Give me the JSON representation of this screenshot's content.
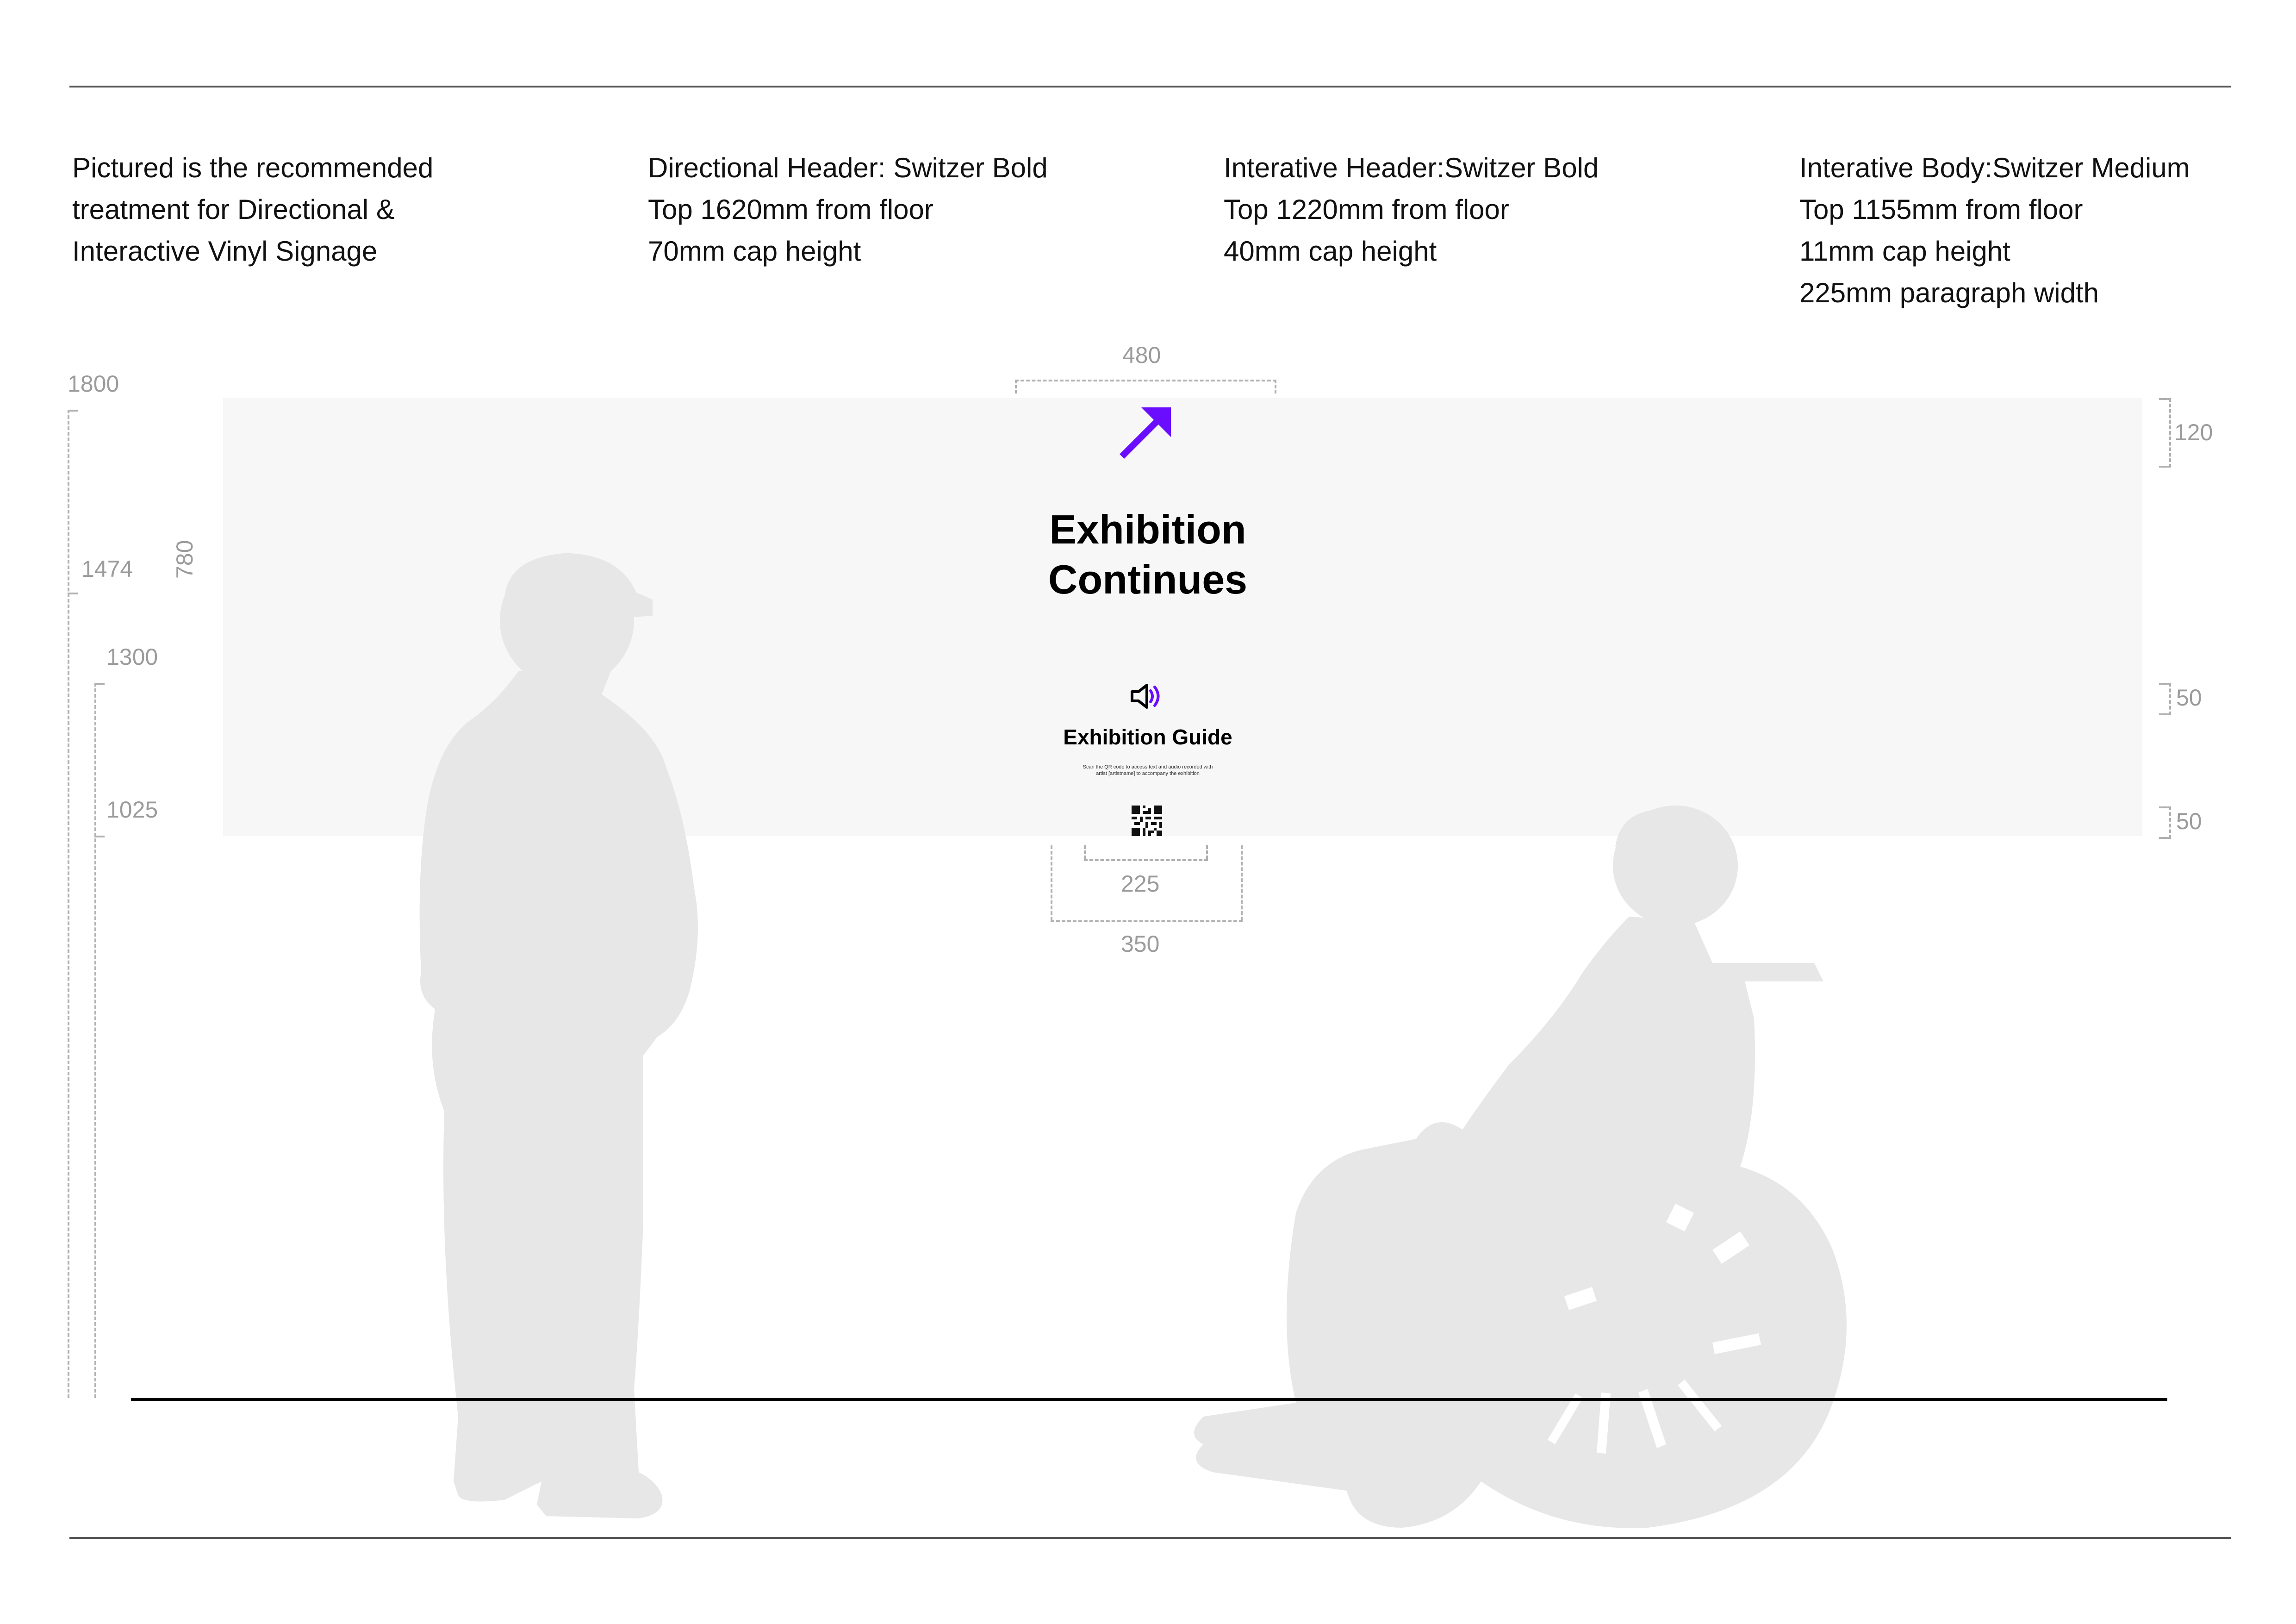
{
  "notes": {
    "col1": [
      "Pictured is the recommended",
      "treatment for Directional &",
      "Interactive Vinyl Signage"
    ],
    "col2": [
      "Directional Header: Switzer Bold",
      "Top 1620mm from floor",
      "70mm cap height"
    ],
    "col3": [
      "Interative Header:Switzer Bold",
      "Top 1220mm from floor",
      "40mm cap height"
    ],
    "col4": [
      "Interative Body:Switzer Medium",
      "Top 1155mm from floor",
      "11mm cap height",
      "225mm paragraph width"
    ]
  },
  "dimensions": {
    "h1800": "1800",
    "h1474": "1474",
    "h1300": "1300",
    "h1025": "1025",
    "panel_height": "780",
    "arrow_width": "480",
    "arrow_top": "120",
    "gap_upper": "50",
    "gap_lower": "50",
    "body_width": "225",
    "guide_width": "350"
  },
  "sign": {
    "header_line1": "Exhibition",
    "header_line2": "Continues",
    "guide_title": "Exhibition Guide",
    "guide_body": "Scan the QR code to access text and audio recorded with artist [artistname] to accompany the exhibition"
  },
  "icons": {
    "arrow": "arrow-up-right-icon",
    "speaker": "speaker-icon",
    "qr": "qr-code-icon"
  },
  "colors": {
    "accent": "#6a0dff",
    "silhouette": "#e7e7e7",
    "panel": "#f7f7f7",
    "dimension": "#9b9b9b"
  }
}
